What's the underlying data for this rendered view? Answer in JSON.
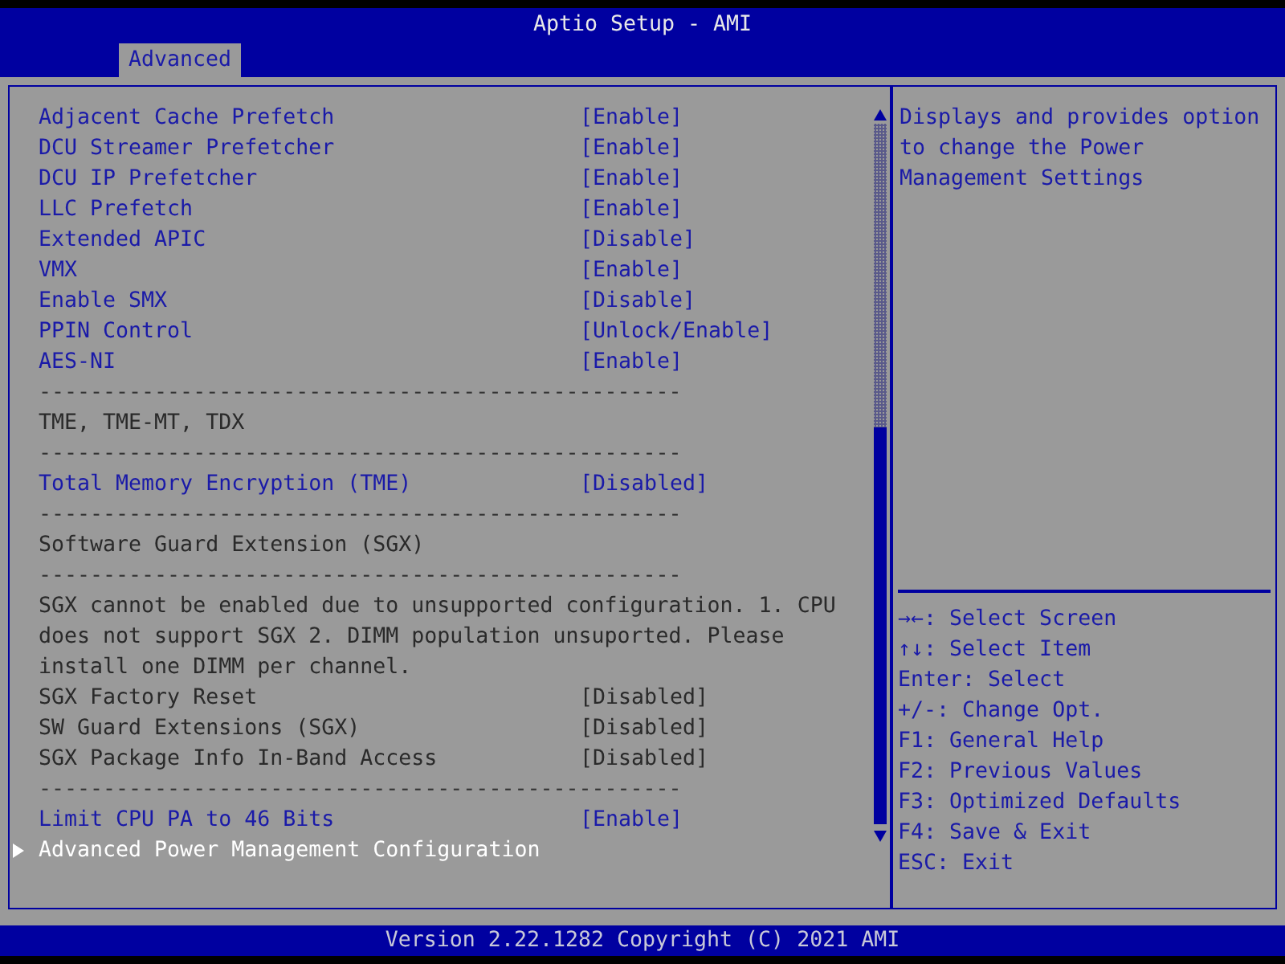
{
  "header": {
    "title": "Aptio Setup - AMI",
    "tabs": [
      {
        "label": "Advanced",
        "selected": true
      }
    ]
  },
  "items": [
    {
      "kind": "setting",
      "label": "Adjacent Cache Prefetch",
      "value": "[Enable]",
      "disabled": false,
      "selected": false
    },
    {
      "kind": "setting",
      "label": "DCU Streamer Prefetcher",
      "value": "[Enable]",
      "disabled": false,
      "selected": false
    },
    {
      "kind": "setting",
      "label": "DCU IP Prefetcher",
      "value": "[Enable]",
      "disabled": false,
      "selected": false
    },
    {
      "kind": "setting",
      "label": "LLC Prefetch",
      "value": "[Enable]",
      "disabled": false,
      "selected": false
    },
    {
      "kind": "setting",
      "label": "Extended APIC",
      "value": "[Disable]",
      "disabled": false,
      "selected": false
    },
    {
      "kind": "setting",
      "label": "VMX",
      "value": "[Enable]",
      "disabled": false,
      "selected": false
    },
    {
      "kind": "setting",
      "label": "Enable SMX",
      "value": "[Disable]",
      "disabled": false,
      "selected": false
    },
    {
      "kind": "setting",
      "label": "PPIN Control",
      "value": "[Unlock/Enable]",
      "disabled": false,
      "selected": false
    },
    {
      "kind": "setting",
      "label": "AES-NI",
      "value": "[Enable]",
      "disabled": false,
      "selected": false
    },
    {
      "kind": "separator",
      "label": "--------------------------------------------------"
    },
    {
      "kind": "heading",
      "label": "TME, TME-MT, TDX"
    },
    {
      "kind": "separator",
      "label": "--------------------------------------------------"
    },
    {
      "kind": "setting",
      "label": "Total Memory Encryption (TME)",
      "value": "[Disabled]",
      "disabled": false,
      "selected": false
    },
    {
      "kind": "separator",
      "label": "--------------------------------------------------"
    },
    {
      "kind": "heading",
      "label": "Software Guard Extension (SGX)"
    },
    {
      "kind": "separator",
      "label": "--------------------------------------------------"
    },
    {
      "kind": "note",
      "label": "SGX cannot be enabled due to unsupported configuration. 1. CPU does not support SGX 2. DIMM population unsuported. Please install one DIMM per channel."
    },
    {
      "kind": "setting",
      "label": "SGX Factory Reset",
      "value": "[Disabled]",
      "disabled": true,
      "selected": false
    },
    {
      "kind": "setting",
      "label": "SW Guard Extensions (SGX)",
      "value": "[Disabled]",
      "disabled": true,
      "selected": false
    },
    {
      "kind": "setting",
      "label": "SGX Package Info In-Band Access",
      "value": "[Disabled]",
      "disabled": true,
      "selected": false
    },
    {
      "kind": "separator",
      "label": "--------------------------------------------------"
    },
    {
      "kind": "setting",
      "label": "Limit CPU PA to 46 Bits",
      "value": "[Enable]",
      "disabled": false,
      "selected": false
    },
    {
      "kind": "submenu",
      "label": "Advanced Power Management Configuration",
      "selected": true
    }
  ],
  "help": "Displays and provides option to change the Power Management Settings",
  "keys": [
    "→←: Select Screen",
    "↑↓: Select Item",
    "Enter: Select",
    "+/-: Change Opt.",
    "F1: General Help",
    "F2: Previous Values",
    "F3: Optimized Defaults",
    "F4: Save & Exit",
    "ESC: Exit"
  ],
  "footer": "Version 2.22.1282 Copyright (C) 2021 AMI"
}
